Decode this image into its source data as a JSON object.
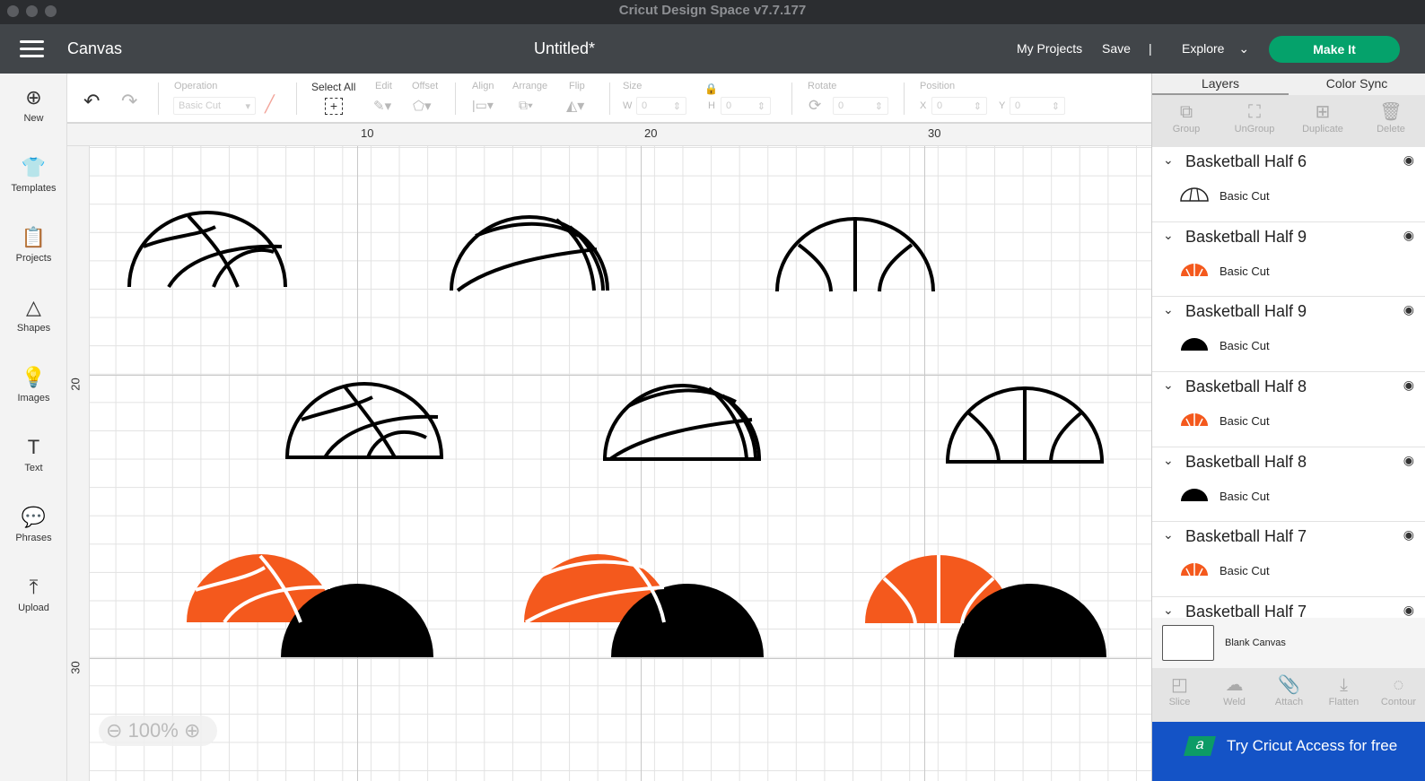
{
  "window": {
    "title": "Cricut Design Space  v7.7.177"
  },
  "header": {
    "section": "Canvas",
    "document": "Untitled*",
    "my_projects": "My Projects",
    "save": "Save",
    "divider": "|",
    "explore": "Explore",
    "make_it": "Make It"
  },
  "toolbar": {
    "operation_label": "Operation",
    "operation_value": "Basic Cut",
    "select_all": "Select All",
    "edit": "Edit",
    "offset": "Offset",
    "align": "Align",
    "arrange": "Arrange",
    "flip": "Flip",
    "size": "Size",
    "w_label": "W",
    "w_value": "0",
    "h_label": "H",
    "h_value": "0",
    "rotate": "Rotate",
    "rotate_value": "0",
    "position": "Position",
    "x_label": "X",
    "x_value": "0",
    "y_label": "Y",
    "y_value": "0"
  },
  "sidebar": {
    "items": [
      {
        "label": "New",
        "icon": "⊕"
      },
      {
        "label": "Templates",
        "icon": "👕"
      },
      {
        "label": "Projects",
        "icon": "📋"
      },
      {
        "label": "Shapes",
        "icon": "△"
      },
      {
        "label": "Images",
        "icon": "💡"
      },
      {
        "label": "Text",
        "icon": "T"
      },
      {
        "label": "Phrases",
        "icon": "💬"
      },
      {
        "label": "Upload",
        "icon": "⤒"
      }
    ]
  },
  "rulers": {
    "top": [
      "10",
      "20",
      "30"
    ],
    "left": [
      "20",
      "30"
    ]
  },
  "zoom": {
    "level": "100%"
  },
  "colors": {
    "orange": "#f4591d",
    "black": "#000000",
    "make_it": "#05a26b",
    "access": "#1453c6"
  },
  "panel": {
    "tabs": [
      "Layers",
      "Color Sync"
    ],
    "tools": [
      {
        "label": "Group",
        "icon": "⧉"
      },
      {
        "label": "UnGroup",
        "icon": "⛶"
      },
      {
        "label": "Duplicate",
        "icon": "⊞"
      },
      {
        "label": "Delete",
        "icon": "🗑"
      }
    ],
    "layers": [
      {
        "name": "Basketball Half 6",
        "op": "Basic Cut",
        "thumb": "outline"
      },
      {
        "name": "Basketball Half 9",
        "op": "Basic Cut",
        "thumb": "orange"
      },
      {
        "name": "Basketball Half 9",
        "op": "Basic Cut",
        "thumb": "black"
      },
      {
        "name": "Basketball Half 8",
        "op": "Basic Cut",
        "thumb": "orange"
      },
      {
        "name": "Basketball Half 8",
        "op": "Basic Cut",
        "thumb": "black"
      },
      {
        "name": "Basketball Half 7",
        "op": "Basic Cut",
        "thumb": "orange"
      },
      {
        "name": "Basketball Half 7",
        "op": "",
        "thumb": ""
      }
    ],
    "blank_canvas": "Blank Canvas",
    "bottom_tools": [
      {
        "label": "Slice",
        "icon": "◰"
      },
      {
        "label": "Weld",
        "icon": "☁"
      },
      {
        "label": "Attach",
        "icon": "📎"
      },
      {
        "label": "Flatten",
        "icon": "⤓"
      },
      {
        "label": "Contour",
        "icon": "◌"
      }
    ],
    "access": "Try Cricut Access for free",
    "access_logo": "a"
  }
}
